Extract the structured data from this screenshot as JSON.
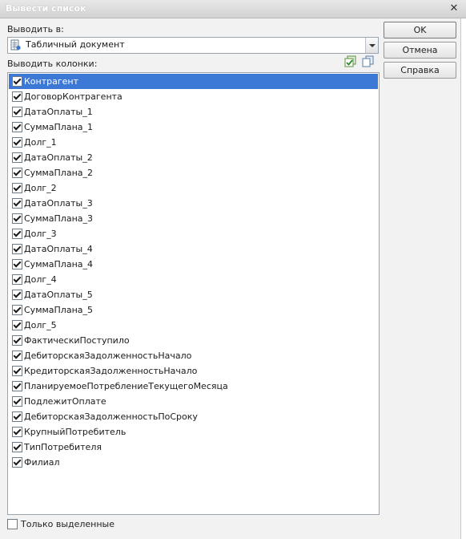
{
  "window": {
    "title": "Вывести список",
    "close_glyph": "✕"
  },
  "output": {
    "label": "Выводить в:",
    "selected": "Табличный документ",
    "icon": "spreadsheet-doc-icon"
  },
  "columns": {
    "label": "Выводить колонки:",
    "toolbar": [
      {
        "icon": "check-all-icon"
      },
      {
        "icon": "uncheck-all-icon"
      }
    ],
    "items": [
      {
        "label": "Контрагент",
        "checked": true,
        "selected": true
      },
      {
        "label": "ДоговорКонтрагента",
        "checked": true
      },
      {
        "label": "ДатаОплаты_1",
        "checked": true
      },
      {
        "label": "СуммаПлана_1",
        "checked": true
      },
      {
        "label": "Долг_1",
        "checked": true
      },
      {
        "label": "ДатаОплаты_2",
        "checked": true
      },
      {
        "label": "СуммаПлана_2",
        "checked": true
      },
      {
        "label": "Долг_2",
        "checked": true
      },
      {
        "label": "ДатаОплаты_3",
        "checked": true
      },
      {
        "label": "СуммаПлана_3",
        "checked": true
      },
      {
        "label": "Долг_3",
        "checked": true
      },
      {
        "label": "ДатаОплаты_4",
        "checked": true
      },
      {
        "label": "СуммаПлана_4",
        "checked": true
      },
      {
        "label": "Долг_4",
        "checked": true
      },
      {
        "label": "ДатаОплаты_5",
        "checked": true
      },
      {
        "label": "СуммаПлана_5",
        "checked": true
      },
      {
        "label": "Долг_5",
        "checked": true
      },
      {
        "label": "ФактическиПоступило",
        "checked": true
      },
      {
        "label": "ДебиторскаяЗадолженностьНачало",
        "checked": true
      },
      {
        "label": "КредиторскаяЗадолженностьНачало",
        "checked": true
      },
      {
        "label": "ПланируемоеПотреблениеТекущегоМесяца",
        "checked": true
      },
      {
        "label": "ПодлежитОплате",
        "checked": true
      },
      {
        "label": "ДебиторскаяЗадолженностьПоСроку",
        "checked": true
      },
      {
        "label": "КрупныйПотребитель",
        "checked": true
      },
      {
        "label": "ТипПотребителя",
        "checked": true
      },
      {
        "label": "Филиал",
        "checked": true
      }
    ]
  },
  "buttons": {
    "ok": "OK",
    "cancel": "Отмена",
    "help": "Справка"
  },
  "only_selected": {
    "label": "Только выделенные",
    "checked": false
  }
}
